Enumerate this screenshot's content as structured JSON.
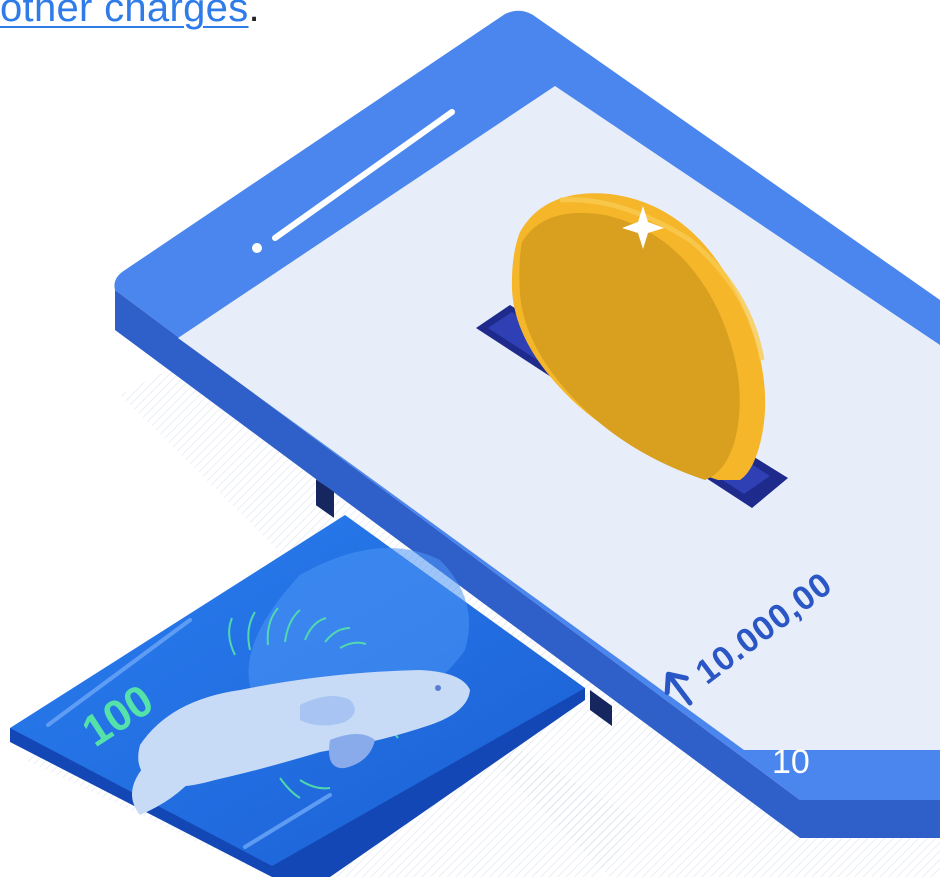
{
  "header": {
    "link_text": "other charges",
    "trailing_punctuation": "."
  },
  "phone": {
    "amount_text": "10.000,00",
    "amount_arrow": "arrow-up-icon"
  },
  "banknote": {
    "denomination": "100"
  },
  "footer": {
    "page_number": "10"
  },
  "colors": {
    "device_blue": "#4a86ee",
    "device_side": "#2f5fc9",
    "screen_bg": "#e8eef9",
    "coin_gold": "#f5b62a",
    "coin_face": "#d9a020",
    "slot_navy": "#1e2a8c",
    "banknote_blue": "#1e6fe0",
    "banknote_green": "#54e2a8",
    "link_blue": "#2f7be8",
    "amount_blue": "#2a56c6"
  }
}
